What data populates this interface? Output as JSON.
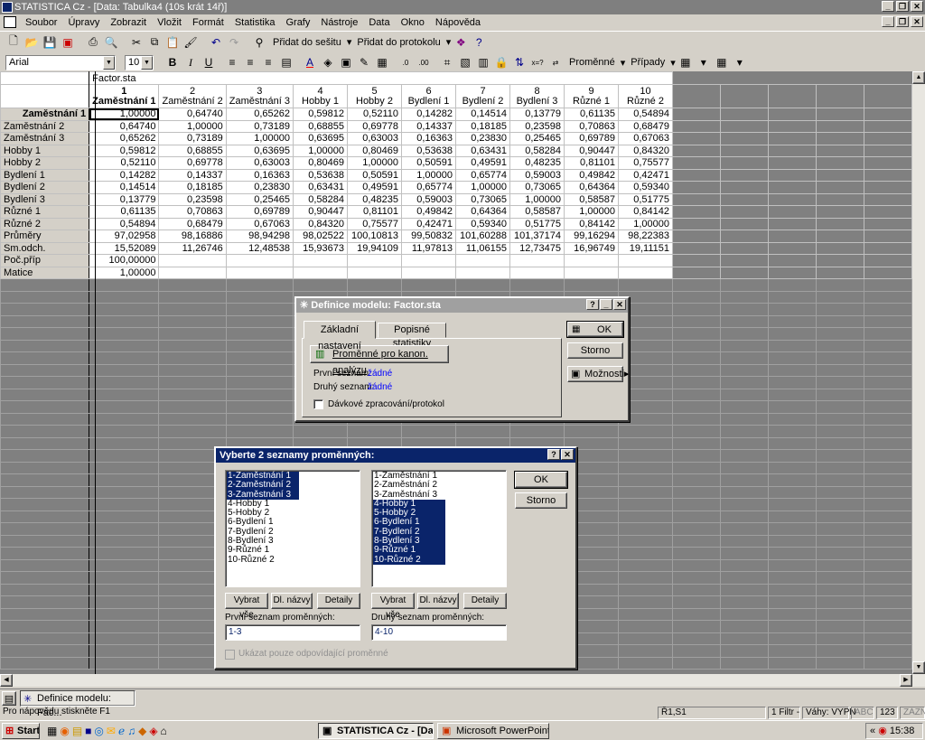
{
  "window": {
    "title": "STATISTICA Cz - [Data: Tabulka4 (10s krát 14ř)]"
  },
  "menu": [
    "Soubor",
    "Úpravy",
    "Zobrazit",
    "Vložit",
    "Formát",
    "Statistika",
    "Grafy",
    "Nástroje",
    "Data",
    "Okno",
    "Nápověda"
  ],
  "toolbar1": {
    "add_sheet": "Přidat do sešitu",
    "add_protocol": "Přidat do protokolu"
  },
  "toolbar2": {
    "font": "Arial",
    "size": "10",
    "variables": "Proměnné",
    "cases": "Případy"
  },
  "sheet": {
    "name": "Factor.sta",
    "columns": [
      {
        "num": "1",
        "name": "Zaměstnání 1"
      },
      {
        "num": "2",
        "name": "Zaměstnání 2"
      },
      {
        "num": "3",
        "name": "Zaměstnání 3"
      },
      {
        "num": "4",
        "name": "Hobby 1"
      },
      {
        "num": "5",
        "name": "Hobby 2"
      },
      {
        "num": "6",
        "name": "Bydlení 1"
      },
      {
        "num": "7",
        "name": "Bydlení 2"
      },
      {
        "num": "8",
        "name": "Bydlení 3"
      },
      {
        "num": "9",
        "name": "Různé 1"
      },
      {
        "num": "10",
        "name": "Různé 2"
      }
    ],
    "rows": [
      {
        "label": "Zaměstnání 1",
        "values": [
          "1,00000",
          "0,64740",
          "0,65262",
          "0,59812",
          "0,52110",
          "0,14282",
          "0,14514",
          "0,13779",
          "0,61135",
          "0,54894"
        ]
      },
      {
        "label": "Zaměstnání 2",
        "values": [
          "0,64740",
          "1,00000",
          "0,73189",
          "0,68855",
          "0,69778",
          "0,14337",
          "0,18185",
          "0,23598",
          "0,70863",
          "0,68479"
        ]
      },
      {
        "label": "Zaměstnání 3",
        "values": [
          "0,65262",
          "0,73189",
          "1,00000",
          "0,63695",
          "0,63003",
          "0,16363",
          "0,23830",
          "0,25465",
          "0,69789",
          "0,67063"
        ]
      },
      {
        "label": "Hobby 1",
        "values": [
          "0,59812",
          "0,68855",
          "0,63695",
          "1,00000",
          "0,80469",
          "0,53638",
          "0,63431",
          "0,58284",
          "0,90447",
          "0,84320"
        ]
      },
      {
        "label": "Hobby 2",
        "values": [
          "0,52110",
          "0,69778",
          "0,63003",
          "0,80469",
          "1,00000",
          "0,50591",
          "0,49591",
          "0,48235",
          "0,81101",
          "0,75577"
        ]
      },
      {
        "label": "Bydlení 1",
        "values": [
          "0,14282",
          "0,14337",
          "0,16363",
          "0,53638",
          "0,50591",
          "1,00000",
          "0,65774",
          "0,59003",
          "0,49842",
          "0,42471"
        ]
      },
      {
        "label": "Bydlení 2",
        "values": [
          "0,14514",
          "0,18185",
          "0,23830",
          "0,63431",
          "0,49591",
          "0,65774",
          "1,00000",
          "0,73065",
          "0,64364",
          "0,59340"
        ]
      },
      {
        "label": "Bydlení 3",
        "values": [
          "0,13779",
          "0,23598",
          "0,25465",
          "0,58284",
          "0,48235",
          "0,59003",
          "0,73065",
          "1,00000",
          "0,58587",
          "0,51775"
        ]
      },
      {
        "label": "Různé 1",
        "values": [
          "0,61135",
          "0,70863",
          "0,69789",
          "0,90447",
          "0,81101",
          "0,49842",
          "0,64364",
          "0,58587",
          "1,00000",
          "0,84142"
        ]
      },
      {
        "label": "Různé 2",
        "values": [
          "0,54894",
          "0,68479",
          "0,67063",
          "0,84320",
          "0,75577",
          "0,42471",
          "0,59340",
          "0,51775",
          "0,84142",
          "1,00000"
        ]
      },
      {
        "label": "Průměry",
        "values": [
          "97,02958",
          "98,16886",
          "98,94298",
          "98,02522",
          "100,10813",
          "99,50832",
          "101,60288",
          "101,37174",
          "99,16294",
          "98,22383"
        ]
      },
      {
        "label": "Sm.odch.",
        "values": [
          "15,52089",
          "11,26746",
          "12,48538",
          "15,93673",
          "19,94109",
          "11,97813",
          "11,06155",
          "12,73475",
          "16,96749",
          "19,11151"
        ]
      },
      {
        "label": "Poč.příp",
        "values": [
          "100,00000",
          "",
          "",
          "",
          "",
          "",
          "",
          "",
          "",
          ""
        ]
      },
      {
        "label": "Matice",
        "values": [
          "1,00000",
          "",
          "",
          "",
          "",
          "",
          "",
          "",
          "",
          ""
        ]
      }
    ]
  },
  "model_dialog": {
    "title": "Definice modelu: Factor.sta",
    "tabs": [
      "Základní nastavení",
      "Popisné statistiky"
    ],
    "var_button": "Proměnné pro kanon. analýzu",
    "first_label": "První seznam:",
    "first_value": "žádné",
    "second_label": "Druhý seznam:",
    "second_value": "žádné",
    "batch": "Dávkové zpracování/protokol",
    "ok": "OK",
    "cancel": "Storno",
    "options": "Možnosti"
  },
  "vars_dialog": {
    "title": "Vyberte 2 seznamy proměnných:",
    "items": [
      "1-Zaměstnání 1",
      "2-Zaměstnání 2",
      "3-Zaměstnání 3",
      "4-Hobby 1",
      "5-Hobby 2",
      "6-Bydlení 1",
      "7-Bydlení 2",
      "8-Bydlení 3",
      "9-Různé 1",
      "10-Různé 2"
    ],
    "select_all": "Vybrat vše",
    "long_names": "Dl. názvy",
    "details": "Detaily",
    "first_list_label": "První seznam proměnných:",
    "first_list_value": "1-3",
    "second_list_label": "Druhý seznam proměnných:",
    "second_list_value": "4-10",
    "show_only": "Ukázat pouze odpovídající proměnné",
    "ok": "OK",
    "cancel": "Storno"
  },
  "mdi_tab": "Definice modelu: Fac...",
  "status": {
    "help": "Pro nápovědu stiskněte F1",
    "cell": "Ř1,S1",
    "filter": "1  Filtr -",
    "weights": "Váhy: VYPN",
    "abc": "ABC",
    "n123": "123",
    "zazn": "ZÁZN"
  },
  "taskbar": {
    "start": "Start",
    "task1": "STATISTICA Cz - [Dat...",
    "task2": "Microsoft PowerPoint - [...",
    "clock": "15:38"
  }
}
